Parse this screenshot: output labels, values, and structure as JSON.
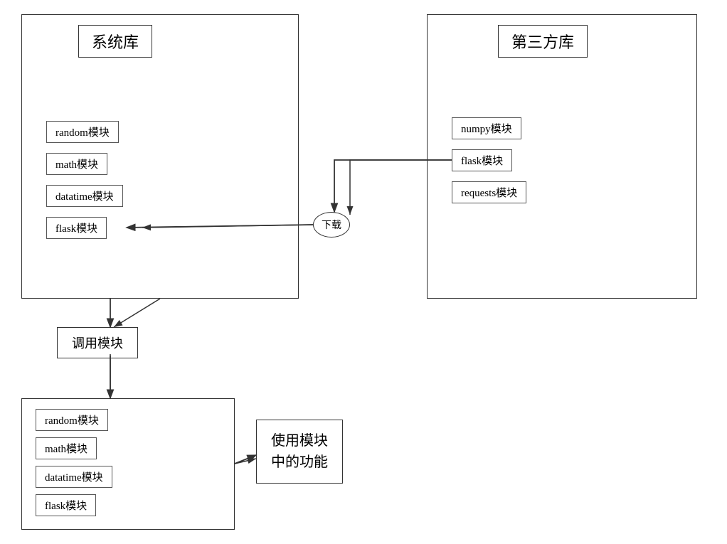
{
  "system_lib": {
    "title": "系统库",
    "modules": [
      "random模块",
      "math模块",
      "datatime模块",
      "flask模块"
    ]
  },
  "third_party": {
    "title": "第三方库",
    "modules": [
      "numpy模块",
      "flask模块",
      "requests模块"
    ]
  },
  "invoke": {
    "label": "调用模块"
  },
  "download": {
    "label": "下载"
  },
  "bottom_modules": [
    "random模块",
    "math模块",
    "datatime模块",
    "flask模块"
  ],
  "use_module": {
    "line1": "使用模块",
    "line2": "中的功能"
  }
}
